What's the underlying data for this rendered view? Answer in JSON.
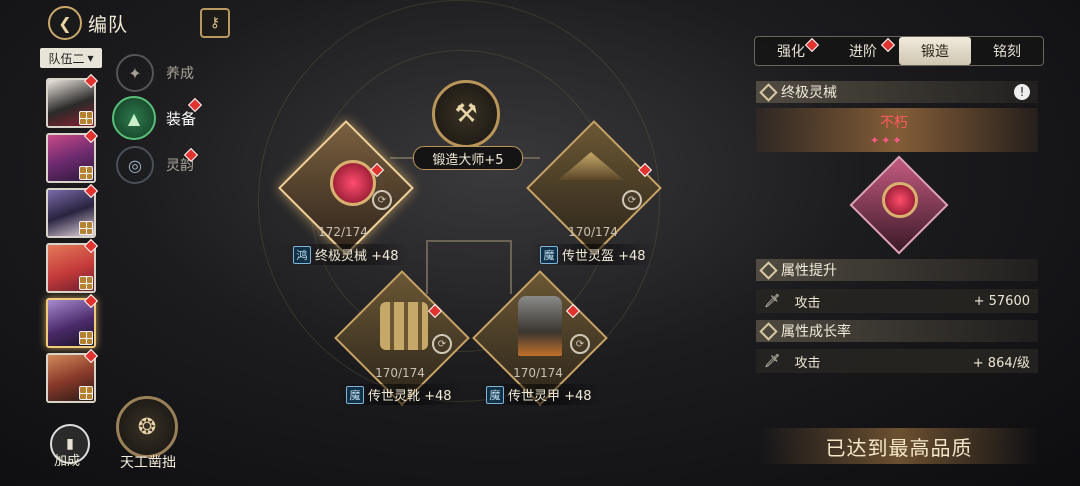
{
  "header": {
    "title": "编队",
    "back_icon": "back-arrow-icon",
    "key_icon": "keyhole-icon"
  },
  "team_selector": {
    "value": "队伍二"
  },
  "side_nav": [
    {
      "label": "养成",
      "icon": "cultivate-icon"
    },
    {
      "label": "装备",
      "icon": "equipment-icon"
    },
    {
      "label": "灵韵",
      "icon": "spirit-icon"
    }
  ],
  "bonus_button": {
    "label": "加成"
  },
  "craft_button": {
    "label": "天工凿拙"
  },
  "forge_master": {
    "label": "锻造大师+5"
  },
  "equipment": [
    {
      "name": "终极灵械 +48",
      "progress": "172/174",
      "badge": "鸿"
    },
    {
      "name": "传世灵盔 +48",
      "progress": "170/174",
      "badge": "魔"
    },
    {
      "name": "传世灵靴 +48",
      "progress": "170/174",
      "badge": "魔"
    },
    {
      "name": "传世灵甲 +48",
      "progress": "170/174",
      "badge": "魔"
    }
  ],
  "tabs": [
    "强化",
    "进阶",
    "锻造",
    "铭刻"
  ],
  "active_tab": "锻造",
  "detail": {
    "item_name": "终极灵械",
    "quality": "不朽",
    "attr_boost_title": "属性提升",
    "attr_boost": {
      "name": "攻击",
      "value": "+ 57600"
    },
    "attr_growth_title": "属性成长率",
    "attr_growth": {
      "name": "攻击",
      "value": "+ 864/级"
    },
    "status": "已达到最高品质"
  },
  "colors": {
    "accent": "#c7a365",
    "alert": "#e0332f",
    "text": "#f1ead8"
  }
}
